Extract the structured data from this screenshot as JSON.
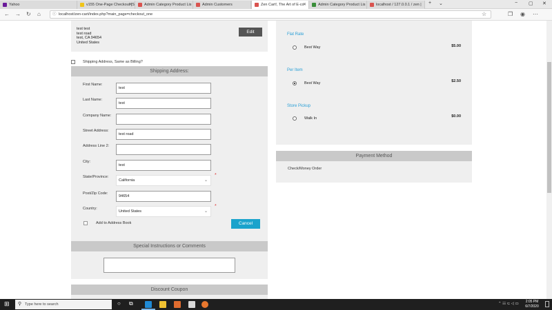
{
  "tabs": [
    {
      "label": "Yahoo",
      "color": "#6a1b9a"
    },
    {
      "label": "v155 One-Page Checkout [S",
      "color": "#f0c419"
    },
    {
      "label": "Admin Category Product Lis",
      "color": "#d9534f"
    },
    {
      "label": "Admin Customers",
      "color": "#d9534f"
    },
    {
      "label": "Zen Cart!, The Art of E-co",
      "color": "#d9534f"
    },
    {
      "label": "Admin Category Product Lis",
      "color": "#3a8e3a"
    },
    {
      "label": "localhost / 127.0.0.1 / zen |",
      "color": "#d9534f"
    }
  ],
  "browser": {
    "url": "localhost/zen-cart/index.php?main_page=checkout_one",
    "new_tab": "+",
    "dropdown": "⌄",
    "minimize": "−",
    "maximize": "▢",
    "close": "✕",
    "back": "←",
    "forward": "→",
    "reload": "↻",
    "home": "⌂",
    "favorite": "☆",
    "collections": "❐",
    "profile": "◉",
    "menu": "⋯",
    "info": "ⓘ"
  },
  "billing": {
    "lines": [
      "test test",
      "test road",
      "test, CA 94654",
      "United States"
    ],
    "edit_label": "Edit"
  },
  "same_as_billing_label": "Shipping Address, Same as Billing?",
  "shipping_address": {
    "header": "Shipping Address:",
    "fields": [
      {
        "label": "First Name:",
        "value": "test"
      },
      {
        "label": "Last Name:",
        "value": "test"
      },
      {
        "label": "Company Name:",
        "value": ""
      },
      {
        "label": "Street Address:",
        "value": "test road"
      },
      {
        "label": "Address Line 2:",
        "value": ""
      },
      {
        "label": "City:",
        "value": "test"
      }
    ],
    "state_label": "State/Province:",
    "state_value": "California",
    "zip_label": "Post/Zip Code:",
    "zip_value": "94654",
    "country_label": "Country:",
    "country_value": "United States",
    "required_mark": "*",
    "add_book_label": "Add to Address Book",
    "cancel_label": "Cancel"
  },
  "special_instructions": {
    "header": "Special Instructions or Comments"
  },
  "discount_coupon": {
    "header": "Discount Coupon"
  },
  "shipping_methods": [
    {
      "heading": "Flat Rate",
      "name": "Best Way",
      "price": "$5.00",
      "selected": false
    },
    {
      "heading": "Per Item",
      "name": "Best Way",
      "price": "$2.50",
      "selected": true
    },
    {
      "heading": "Store Pickup",
      "name": "Walk In",
      "price": "$0.00",
      "selected": false
    }
  ],
  "payment": {
    "header": "Payment Method",
    "method": "Check/Money Order"
  },
  "taskbar": {
    "search_placeholder": "Type here to search",
    "time": "2:05 PM",
    "date": "6/7/2020",
    "start": "⊞",
    "search_glyph": "⚲",
    "cortana": "○",
    "task_view": "⧉",
    "tray": "⌃ ☷ ⊂ ◁ ▭"
  },
  "colors": {
    "accent": "#1ba3cc",
    "heading": "#2a9fd6",
    "header_bar": "#c9c9c9",
    "panel": "#efefef"
  }
}
